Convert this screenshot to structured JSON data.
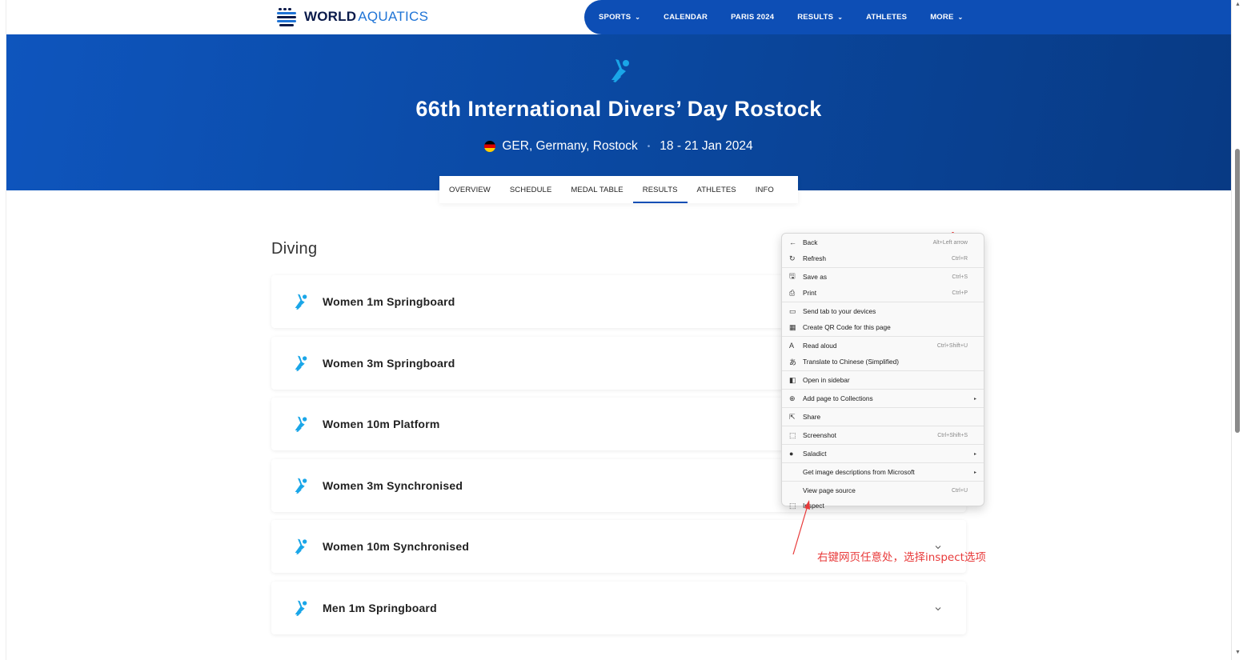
{
  "logo": {
    "word1": "WORLD",
    "word2": "AQUATICS"
  },
  "nav": {
    "items": [
      {
        "label": "SPORTS",
        "chevron": "⌄"
      },
      {
        "label": "CALENDAR",
        "chevron": ""
      },
      {
        "label": "PARIS 2024",
        "chevron": ""
      },
      {
        "label": "RESULTS",
        "chevron": "⌄"
      },
      {
        "label": "ATHLETES",
        "chevron": ""
      },
      {
        "label": "MORE",
        "chevron": "⌄"
      }
    ]
  },
  "hero": {
    "title": "66th International Divers’ Day Rostock",
    "location": "GER, Germany, Rostock",
    "separator": "•",
    "dates": "18 - 21 Jan 2024"
  },
  "subnav": {
    "items": [
      "OVERVIEW",
      "SCHEDULE",
      "MEDAL TABLE",
      "RESULTS",
      "ATHLETES",
      "INFO"
    ],
    "active": "RESULTS"
  },
  "section": {
    "title": "Diving"
  },
  "events": [
    {
      "name": "Women 1m Springboard"
    },
    {
      "name": "Women 3m Springboard"
    },
    {
      "name": "Women 10m Platform"
    },
    {
      "name": "Women 3m Synchronised"
    },
    {
      "name": "Women 10m Synchronised"
    },
    {
      "name": "Men 1m Springboard"
    }
  ],
  "context_menu": {
    "items": [
      {
        "icon": "←",
        "icon_name": "back-arrow-icon",
        "label": "Back",
        "shortcut": "Alt+Left arrow",
        "submenu": false
      },
      {
        "icon": "↻",
        "icon_name": "refresh-icon",
        "label": "Refresh",
        "shortcut": "Ctrl+R",
        "submenu": false
      },
      {
        "icon": "🖫",
        "icon_name": "save-icon",
        "label": "Save as",
        "shortcut": "Ctrl+S",
        "submenu": false
      },
      {
        "icon": "⎙",
        "icon_name": "print-icon",
        "label": "Print",
        "shortcut": "Ctrl+P",
        "submenu": false
      },
      {
        "icon": "▭",
        "icon_name": "send-tab-icon",
        "label": "Send tab to your devices",
        "shortcut": "",
        "submenu": false
      },
      {
        "icon": "▦",
        "icon_name": "qr-code-icon",
        "label": "Create QR Code for this page",
        "shortcut": "",
        "submenu": false
      },
      {
        "icon": "A",
        "icon_name": "read-aloud-icon",
        "label": "Read aloud",
        "shortcut": "Ctrl+Shift+U",
        "submenu": false
      },
      {
        "icon": "あ",
        "icon_name": "translate-icon",
        "label": "Translate to Chinese (Simplified)",
        "shortcut": "",
        "submenu": false
      },
      {
        "icon": "◧",
        "icon_name": "sidebar-icon",
        "label": "Open in sidebar",
        "shortcut": "",
        "submenu": false
      },
      {
        "icon": "⊕",
        "icon_name": "collections-icon",
        "label": "Add page to Collections",
        "shortcut": "",
        "submenu": true
      },
      {
        "icon": "⇱",
        "icon_name": "share-icon",
        "label": "Share",
        "shortcut": "",
        "submenu": false
      },
      {
        "icon": "⬚",
        "icon_name": "screenshot-icon",
        "label": "Screenshot",
        "shortcut": "Ctrl+Shift+S",
        "submenu": false
      },
      {
        "icon": "●",
        "icon_name": "saladict-icon",
        "label": "Saladict",
        "shortcut": "",
        "submenu": true
      },
      {
        "icon": "",
        "icon_name": "",
        "label": "Get image descriptions from Microsoft",
        "shortcut": "",
        "submenu": true
      },
      {
        "icon": "",
        "icon_name": "",
        "label": "View page source",
        "shortcut": "Ctrl+U",
        "submenu": false
      },
      {
        "icon": "⬚",
        "icon_name": "inspect-icon",
        "label": "Inspect",
        "shortcut": "",
        "submenu": false
      }
    ],
    "submenu_arrow": "▸"
  },
  "annotation": {
    "text": "右键网页任意处，选择inspect选项",
    "color": "#e83a3a"
  },
  "colors": {
    "brand_blue": "#0d4eb5",
    "accent_cyan": "#1aa6e8",
    "logo_navy": "#0a1a4a"
  }
}
